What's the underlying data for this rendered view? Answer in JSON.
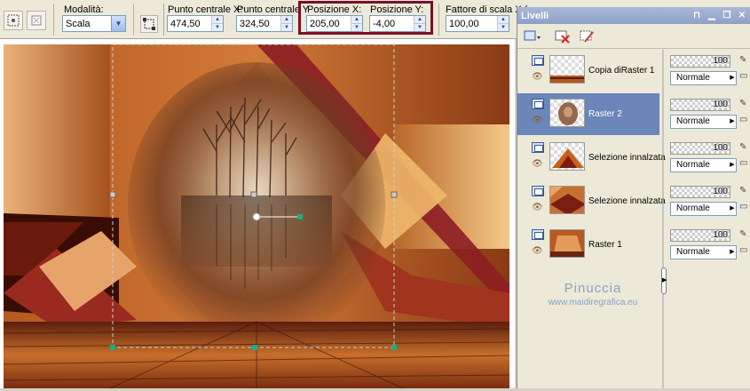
{
  "toolbar": {
    "mode_label": "Modalità:",
    "mode_value": "Scala",
    "center_x_label": "Punto centrale X:",
    "center_x_value": "474,50",
    "center_y_label": "Punto centrale Y",
    "center_y_value": "324,50",
    "pos_x_label": "Posizione X:",
    "pos_x_value": "205,00",
    "pos_y_label": "Posizione Y:",
    "pos_y_value": "-4,00",
    "scale_label": "Fattore di scala X (",
    "scale_value": "100,00"
  },
  "layers_panel": {
    "title": "Livelli",
    "layers": [
      {
        "name": "Copia diRaster 1",
        "opacity": "100",
        "blend": "Normale",
        "selected": false
      },
      {
        "name": "Raster 2",
        "opacity": "100",
        "blend": "Normale",
        "selected": true
      },
      {
        "name": "Selezione innalzata",
        "opacity": "100",
        "blend": "Normale",
        "selected": false
      },
      {
        "name": "Selezione innalzata",
        "opacity": "100",
        "blend": "Normale",
        "selected": false
      },
      {
        "name": "Raster 1",
        "opacity": "100",
        "blend": "Normale",
        "selected": false
      }
    ]
  },
  "watermark": {
    "name": "Pinuccia",
    "site": "www.maidiregrafica.eu"
  },
  "colors": {
    "highlight": "#7a1028",
    "selection_bg": "#6b86b8",
    "titlebar": "#8da0c8",
    "handle": "#22aa88"
  },
  "icons": {
    "deform_tool": "deform-tool-icon",
    "reset": "reset-icon",
    "layer_type": "raster-layer-icon",
    "visibility": "eye-icon",
    "new_layer": "new-layer-icon",
    "delete_layer": "delete-layer-icon",
    "edit_layer": "edit-layer-icon",
    "link": "link-icon",
    "lock": "lock-icon"
  }
}
